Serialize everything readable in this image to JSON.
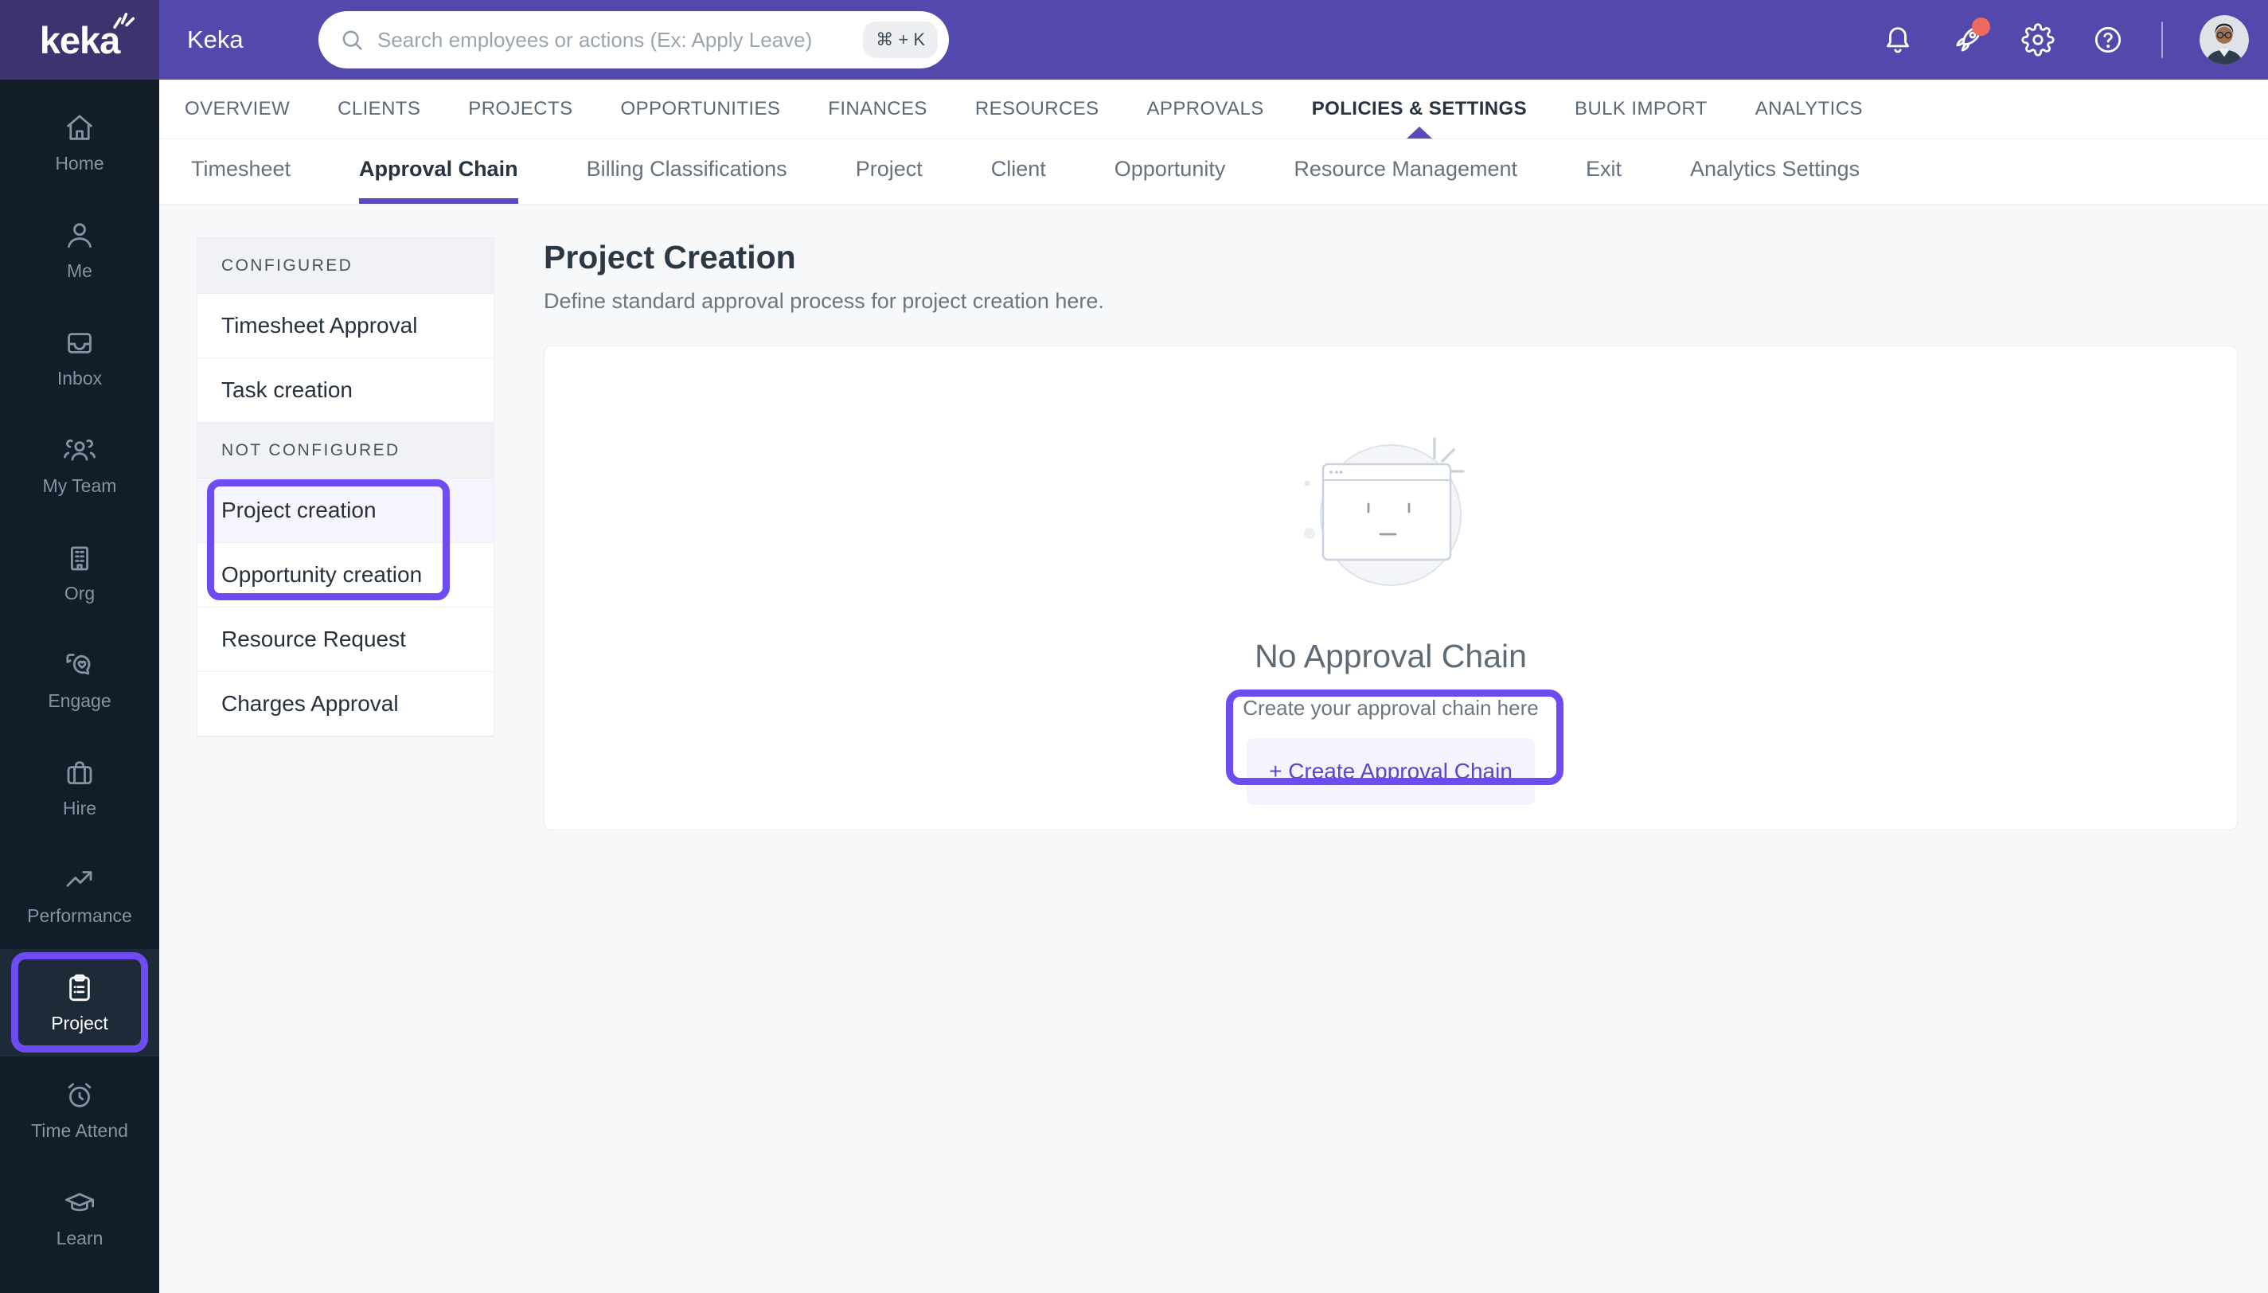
{
  "topbar": {
    "brand": "keka",
    "app_title": "Keka",
    "search_placeholder": "Search employees or actions (Ex: Apply Leave)",
    "shortcut": "⌘ + K"
  },
  "sidebar": {
    "items": [
      {
        "label": "Home",
        "icon": "home-icon"
      },
      {
        "label": "Me",
        "icon": "user-icon"
      },
      {
        "label": "Inbox",
        "icon": "inbox-icon"
      },
      {
        "label": "My Team",
        "icon": "team-icon"
      },
      {
        "label": "Org",
        "icon": "building-icon"
      },
      {
        "label": "Engage",
        "icon": "chat-heart-icon"
      },
      {
        "label": "Hire",
        "icon": "briefcase-icon"
      },
      {
        "label": "Performance",
        "icon": "trend-up-icon"
      },
      {
        "label": "Project",
        "icon": "clipboard-icon",
        "active": true
      },
      {
        "label": "Time Attend",
        "icon": "alarm-clock-icon"
      },
      {
        "label": "Learn",
        "icon": "graduation-cap-icon"
      }
    ]
  },
  "main_nav": {
    "items": [
      {
        "label": "OVERVIEW"
      },
      {
        "label": "CLIENTS"
      },
      {
        "label": "PROJECTS"
      },
      {
        "label": "OPPORTUNITIES"
      },
      {
        "label": "FINANCES"
      },
      {
        "label": "RESOURCES"
      },
      {
        "label": "APPROVALS"
      },
      {
        "label": "POLICIES & SETTINGS",
        "active": true
      },
      {
        "label": "BULK IMPORT"
      },
      {
        "label": "ANALYTICS"
      }
    ]
  },
  "sub_nav": {
    "items": [
      {
        "label": "Timesheet"
      },
      {
        "label": "Approval Chain",
        "active": true
      },
      {
        "label": "Billing Classifications"
      },
      {
        "label": "Project"
      },
      {
        "label": "Client"
      },
      {
        "label": "Opportunity"
      },
      {
        "label": "Resource Management"
      },
      {
        "label": "Exit"
      },
      {
        "label": "Analytics Settings"
      }
    ]
  },
  "panel": {
    "sections": [
      {
        "header": "CONFIGURED",
        "items": [
          {
            "label": "Timesheet Approval"
          },
          {
            "label": "Task creation"
          }
        ]
      },
      {
        "header": "NOT CONFIGURED",
        "items": [
          {
            "label": "Project creation",
            "selected": true
          },
          {
            "label": "Opportunity creation"
          },
          {
            "label": "Resource Request"
          },
          {
            "label": "Charges Approval"
          }
        ]
      }
    ]
  },
  "content": {
    "title": "Project Creation",
    "subtitle": "Define standard approval process for project creation here.",
    "empty_title": "No Approval Chain",
    "empty_subtitle": "Create your approval chain here",
    "create_button_label": "+ Create Approval Chain"
  },
  "colors": {
    "accent": "#5b46c6",
    "annotation_highlight": "#6e4cf1",
    "topbar": "#5348ab",
    "logo_bg": "#3d336e",
    "sidebar_bg": "#111d29",
    "notification_dot": "#ef6a5e"
  }
}
